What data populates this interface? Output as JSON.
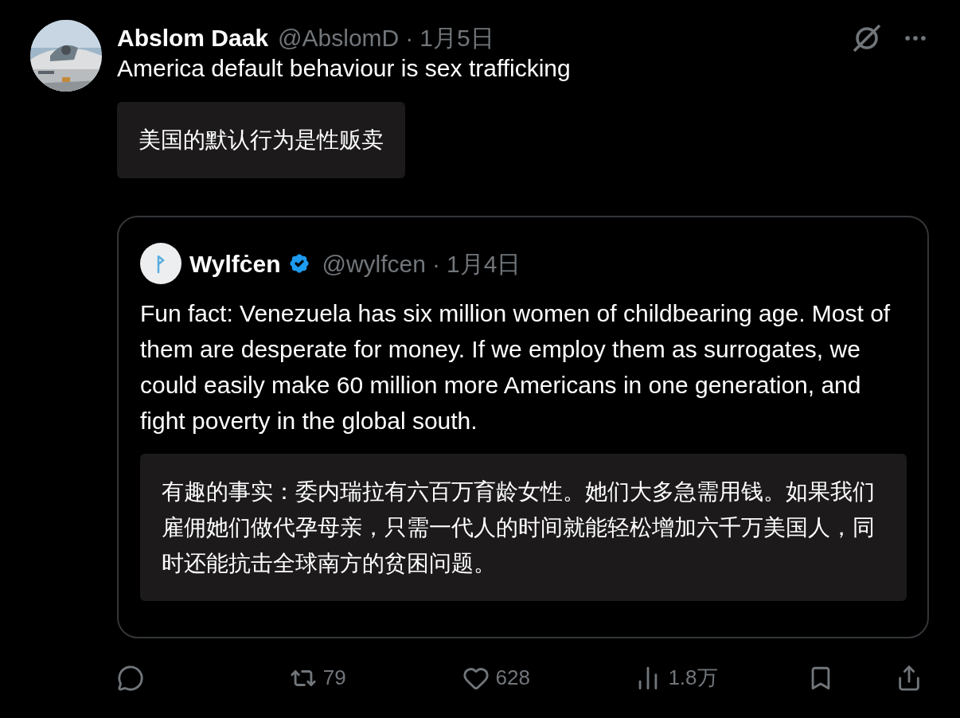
{
  "post": {
    "author": {
      "name": "Abslom Daak",
      "handle": "@AbslomD",
      "separator": "·",
      "date": "1月5日"
    },
    "text": "America default behaviour is sex trafficking",
    "translation": "美国的默认行为是性贩卖",
    "quote": {
      "author": {
        "name": "Wylfċen",
        "verified": true,
        "handle": "@wylfcen",
        "separator": "·",
        "date": "1月4日"
      },
      "text": "Fun fact: Venezuela has six million women of childbearing age. Most of them are desperate for money. If we employ them as surrogates, we could easily make 60 million more Americans in one generation, and fight poverty in the global south.",
      "translation": "有趣的事实：委内瑞拉有六百万育龄女性。她们大多急需用钱。如果我们雇佣她们做代孕母亲，只需一代人的时间就能轻松增加六千万美国人，同时还能抗击全球南方的贫困问题。"
    },
    "actions": [
      {
        "kind": "reply"
      },
      {
        "kind": "repost",
        "count": "79"
      },
      {
        "kind": "like",
        "count": "628"
      },
      {
        "kind": "views",
        "count": "1.8万"
      },
      {
        "kind": "bookmark"
      },
      {
        "kind": "share"
      }
    ]
  }
}
